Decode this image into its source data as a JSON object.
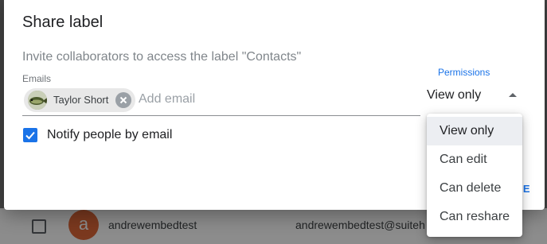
{
  "background_row": {
    "avatar_letter": "a",
    "name": "andrewembedtest",
    "email": "andrewembedtest@suiteh"
  },
  "dialog": {
    "title": "Share label",
    "invite_text": "Invite collaborators to access the label \"Contacts\"",
    "emails_label": "Emails",
    "chip": {
      "name": "Taylor Short",
      "avatar_icon": "fish-avatar-icon",
      "remove_icon": "close-circle-icon"
    },
    "add_email_placeholder": "Add email",
    "permissions_label": "Permissions",
    "permissions_value": "View only",
    "notify": {
      "label": "Notify people by email",
      "checked": true
    },
    "share_button_fragment": "RE"
  },
  "permissions_menu": {
    "options": [
      "View only",
      "Can edit",
      "Can delete",
      "Can reshare"
    ],
    "selected_index": 0
  },
  "colors": {
    "accent": "#1a73e8",
    "avatar_bg": "#e0683a"
  }
}
